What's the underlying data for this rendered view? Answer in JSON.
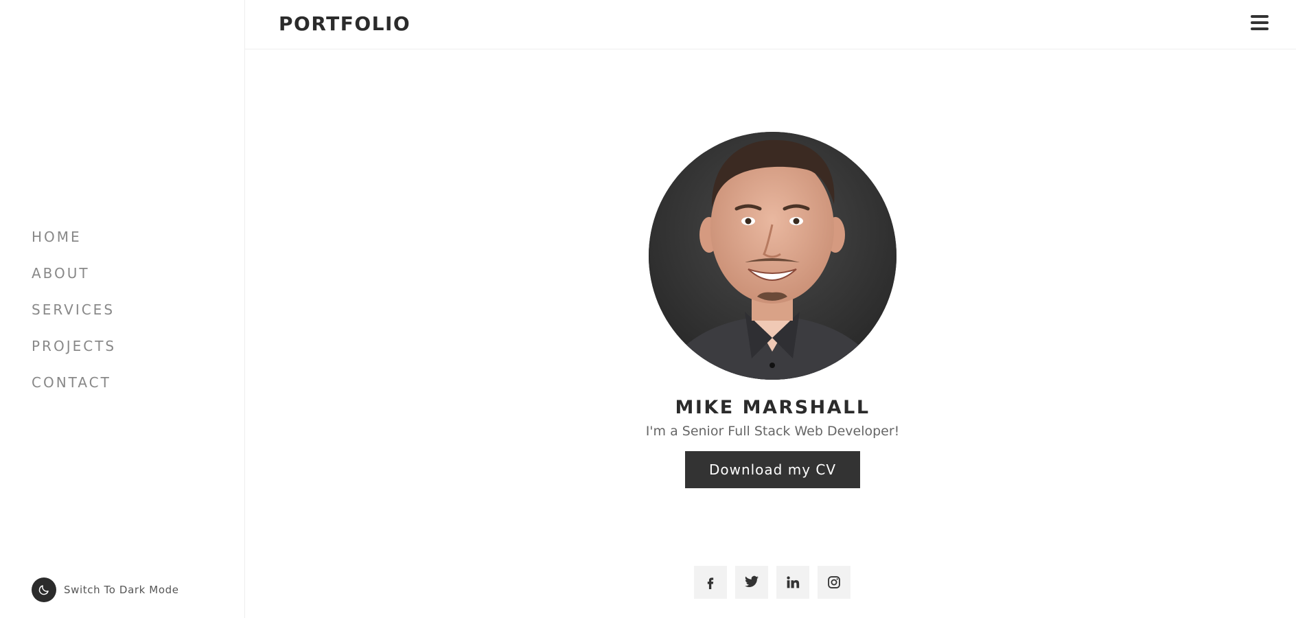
{
  "header": {
    "logo": "PORTFOLIO",
    "menu_icon": "hamburger-menu-icon"
  },
  "sidebar": {
    "items": [
      {
        "label": "HOME"
      },
      {
        "label": "ABOUT"
      },
      {
        "label": "SERVICES"
      },
      {
        "label": "PROJECTS"
      },
      {
        "label": "CONTACT"
      }
    ],
    "dark_mode_label": "Switch To Dark Mode",
    "dark_mode_icon": "moon-icon"
  },
  "hero": {
    "name": "MIKE MARSHALL",
    "tagline": "I'm a Senior Full Stack Web Developer!",
    "cv_button": "Download my CV",
    "socials": [
      {
        "icon": "facebook-icon"
      },
      {
        "icon": "twitter-icon"
      },
      {
        "icon": "linkedin-icon"
      },
      {
        "icon": "instagram-icon"
      }
    ]
  },
  "colors": {
    "accent": "#333333",
    "nav_text": "#888888",
    "social_bg": "#f2f2f2",
    "border": "#eeeeee"
  }
}
